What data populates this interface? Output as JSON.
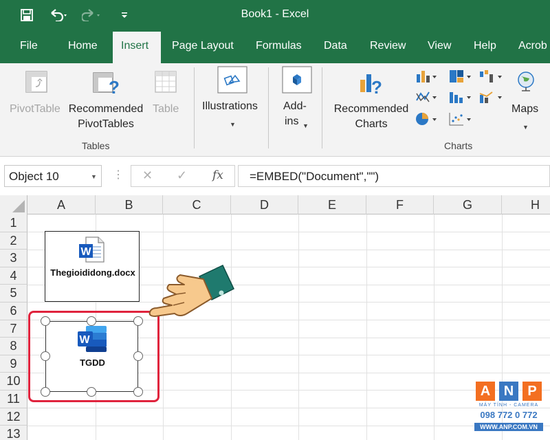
{
  "window": {
    "title": "Book1  -  Excel"
  },
  "quick_access": {
    "icons": [
      "save-icon",
      "undo-icon",
      "redo-icon",
      "customize-icon"
    ]
  },
  "tabs": [
    {
      "label": "File"
    },
    {
      "label": "Home"
    },
    {
      "label": "Insert"
    },
    {
      "label": "Page Layout"
    },
    {
      "label": "Formulas"
    },
    {
      "label": "Data"
    },
    {
      "label": "Review"
    },
    {
      "label": "View"
    },
    {
      "label": "Help"
    },
    {
      "label": "Acrob"
    }
  ],
  "active_tab": "Insert",
  "ribbon": {
    "tables": {
      "pivottable": "PivotTable",
      "recommended_line1": "Recommended",
      "recommended_line2": "PivotTables",
      "table": "Table",
      "group_label": "Tables"
    },
    "illustrations": {
      "label": "Illustrations"
    },
    "addins": {
      "line1": "Add-",
      "line2": "ins"
    },
    "charts": {
      "recommended_line1": "Recommended",
      "recommended_line2": "Charts",
      "maps": "Maps",
      "group_label": "Charts"
    }
  },
  "formula_bar": {
    "name_box": "Object 10",
    "cancel": "✕",
    "enter": "✓",
    "fx": "fx",
    "formula": "=EMBED(\"Document\",\"\")"
  },
  "grid": {
    "columns": [
      "A",
      "B",
      "C",
      "D",
      "E",
      "F",
      "G",
      "H"
    ],
    "rows": [
      "1",
      "2",
      "3",
      "4",
      "5",
      "6",
      "7",
      "8",
      "9",
      "10",
      "11",
      "12",
      "13"
    ]
  },
  "objects": {
    "doc1_caption": "Thegioididong.docx",
    "doc2_caption": "TGDD"
  },
  "watermark": {
    "letters": [
      "A",
      "N",
      "P"
    ],
    "subtitle": "MÁY TÍNH - CAMERA",
    "phone": "098 772 0 772",
    "url": "WWW.ANP.COM.VN"
  },
  "colors": {
    "excel_green": "#217346",
    "highlight_red": "#e0233d",
    "word_blue": "#185abd"
  }
}
